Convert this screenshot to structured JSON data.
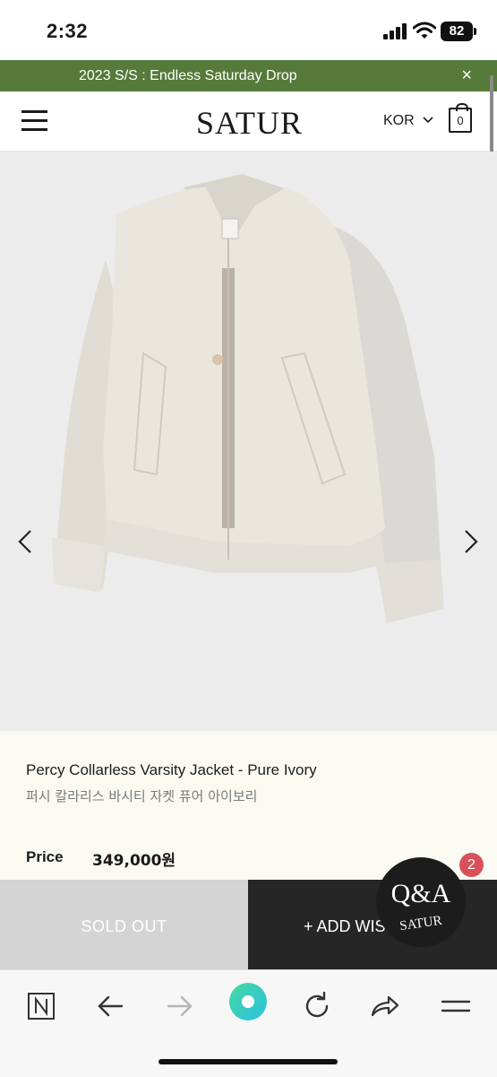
{
  "status_bar": {
    "time": "2:32",
    "battery": "82"
  },
  "promo": {
    "text": "2023 S/S : Endless Saturday Drop",
    "close": "×"
  },
  "header": {
    "logo": "SATUR",
    "language": "KOR",
    "cart_count": "0"
  },
  "product": {
    "name": "Percy Collarless Varsity Jacket - Pure Ivory",
    "name_ko": "퍼시 칼라리스 바시티 자켓 퓨어 아이보리",
    "price_label": "Price",
    "price": "349,000원"
  },
  "actions": {
    "sold_out": "SOLD OUT",
    "wishlist": "+ ADD WISHLIST"
  },
  "qa": {
    "title": "Q&A",
    "sub": "SATUR",
    "count": "2"
  },
  "colors": {
    "banner": "#557a3a",
    "qa_count": "#d9505a",
    "reload_green": "#3fd49a"
  },
  "icons": [
    "signal-icon",
    "wifi-icon",
    "battery-icon",
    "menu-icon",
    "cart-icon",
    "chevron-down-icon",
    "chevron-left-icon",
    "chevron-right-icon",
    "naver-icon",
    "back-arrow-icon",
    "forward-arrow-icon",
    "green-dot-icon",
    "reload-icon",
    "share-icon",
    "menu-lines-icon"
  ]
}
